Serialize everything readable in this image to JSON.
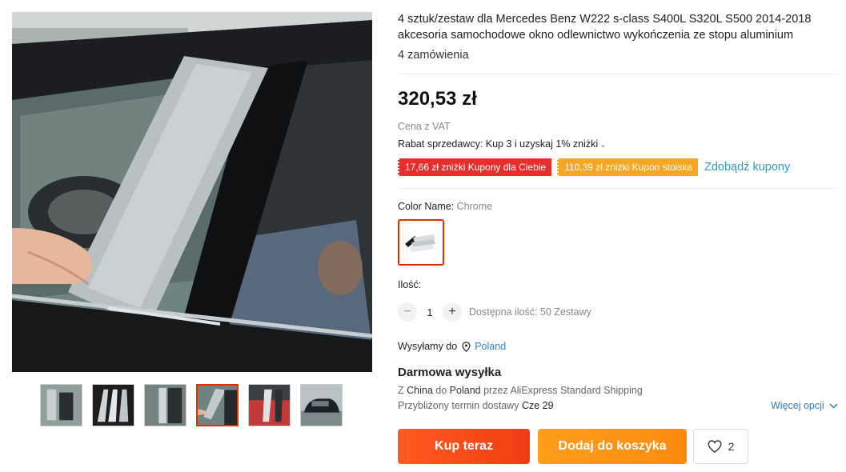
{
  "gallery": {
    "main_image": "car-b-pillar-trim-photo",
    "thumbnails": [
      {
        "name": "thumb-1",
        "active": false
      },
      {
        "name": "thumb-2",
        "active": false
      },
      {
        "name": "thumb-3",
        "active": false
      },
      {
        "name": "thumb-4",
        "active": true
      },
      {
        "name": "thumb-5",
        "active": false
      },
      {
        "name": "thumb-6",
        "active": false
      }
    ]
  },
  "product": {
    "title": "4 sztuk/zestaw dla Mercedes Benz W222 s-class S400L S320L S500 2014-2018 akcesoria samochodowe okno odlewnictwo wykończenia ze stopu aluminium",
    "orders": "4 zamówienia",
    "price": "320,53 zł",
    "vat_note": "Cena z VAT",
    "seller_discount": "Rabat sprzedawcy: Kup 3 i uzyskaj 1% zniżki",
    "coupons": {
      "personal": "17,66 zł zniżki Kupony dla Ciebie",
      "store": "110,39 zł zniżki Kupon stoiska",
      "get_label": "Zdobądź kupony"
    },
    "color": {
      "label": "Color Name:",
      "value": "Chrome"
    },
    "quantity": {
      "label": "Ilość:",
      "value": "1",
      "available": "Dostępna ilość: 50 Zestawy"
    }
  },
  "shipping": {
    "ship_to_label": "Wysyłamy do",
    "ship_to_country": "Poland",
    "free_label": "Darmowa wysyłka",
    "route_from_prefix": "Z",
    "route_from": "China",
    "route_to_prefix": "do",
    "route_to": "Poland",
    "route_via": "przez AliExpress Standard Shipping",
    "eta_label": "Przybliżony termin dostawy",
    "eta_value": "Cze 29",
    "more_options": "Więcej opcji"
  },
  "actions": {
    "buy_now": "Kup teraz",
    "add_to_cart": "Dodaj do koszyka",
    "wishlist_count": "2"
  },
  "colors": {
    "accent_red": "#e62e04",
    "coupon_red": "#e62e2d",
    "coupon_orange": "#f5a623",
    "link_blue": "#2e9cc3",
    "buy_start": "#ff5a1f",
    "cart_start": "#ff9d1b"
  }
}
